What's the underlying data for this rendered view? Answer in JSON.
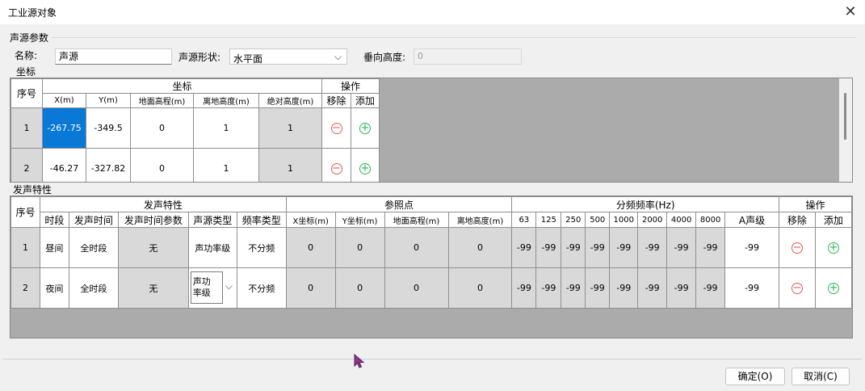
{
  "window": {
    "title": "工业源对象",
    "close_glyph": "✕"
  },
  "params": {
    "section_label": "声源参数",
    "name_label": "名称:",
    "name_value": "声源",
    "shape_label": "声源形状:",
    "shape_value": "水平面",
    "height_label": "垂向高度:",
    "height_value": "0"
  },
  "coords": {
    "section_label": "坐标",
    "headers": {
      "seq": "序号",
      "group": "坐标",
      "ops": "操作",
      "x": "X(m)",
      "y": "Y(m)",
      "ground": "地面高程(m)",
      "above": "离地高度(m)",
      "abs": "绝对高度(m)",
      "remove": "移除",
      "add": "添加"
    },
    "rows": [
      {
        "seq": "1",
        "x": "-267.75",
        "y": "-349.5",
        "ground": "0",
        "above": "1",
        "abs": "1"
      },
      {
        "seq": "2",
        "x": "-46.27",
        "y": "-327.82",
        "ground": "0",
        "above": "1",
        "abs": "1"
      }
    ]
  },
  "emission": {
    "section_label": "发声特性",
    "headers": {
      "seq": "序号",
      "group": "发声特性",
      "ref": "参照点",
      "freq_group": "分频频率(Hz)",
      "ops": "操作",
      "period": "时段",
      "time": "发声时间",
      "time_param": "发声时间参数",
      "src_type": "声源类型",
      "freq_type": "频率类型",
      "rx": "X坐标(m)",
      "ry": "Y坐标(m)",
      "rground": "地面高程(m)",
      "rabove": "离地高度(m)",
      "freqs": [
        "63",
        "125",
        "250",
        "500",
        "1000",
        "2000",
        "4000",
        "8000"
      ],
      "a_level": "A声级",
      "remove": "移除",
      "add": "添加"
    },
    "rows": [
      {
        "seq": "1",
        "period": "昼间",
        "time": "全时段",
        "time_param": "无",
        "src_type": "声功率级",
        "freq_type": "不分频",
        "rx": "0",
        "ry": "0",
        "rground": "0",
        "rabove": "0",
        "f": [
          "-99",
          "-99",
          "-99",
          "-99",
          "-99",
          "-99",
          "-99",
          "-99"
        ],
        "a": "-99"
      },
      {
        "seq": "2",
        "period": "夜间",
        "time": "全时段",
        "time_param": "无",
        "src_type": "声功\n率级",
        "freq_type": "不分频",
        "rx": "0",
        "ry": "0",
        "rground": "0",
        "rabove": "0",
        "f": [
          "-99",
          "-99",
          "-99",
          "-99",
          "-99",
          "-99",
          "-99",
          "-99"
        ],
        "a": "-99"
      }
    ]
  },
  "buttons": {
    "ok": "确定(O)",
    "cancel": "取消(C)"
  },
  "icons": {
    "remove": "minus-circle-icon",
    "add": "plus-circle-icon",
    "close": "close-icon",
    "dropdown": "chevron-down-icon",
    "cursor": "mouse-pointer-icon"
  },
  "colors": {
    "selection": "#0a78d7",
    "remove": "#e25a5a",
    "add": "#2db35a",
    "grid_bg": "#ababab"
  }
}
